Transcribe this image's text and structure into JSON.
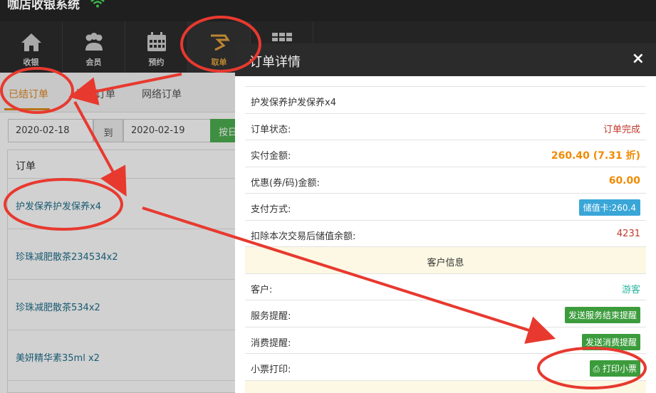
{
  "app": {
    "title": "咖店收银系统"
  },
  "nav": [
    {
      "label": "收银",
      "icon": "home-icon"
    },
    {
      "label": "会员",
      "icon": "users-icon"
    },
    {
      "label": "预约",
      "icon": "calendar-icon"
    },
    {
      "label": "取单",
      "icon": "takeout-icon"
    }
  ],
  "subtabs": [
    "已结订单",
    "挂起订单",
    "网络订单"
  ],
  "filter": {
    "start": "2020-02-18",
    "to": "到",
    "end": "2020-02-19",
    "query": "按日"
  },
  "orders": {
    "header": "订单",
    "rows": [
      "护发保养护发保养x4",
      "珍珠减肥散茶234534x2",
      "珍珠减肥散茶534x2",
      "美妍精华素35ml x2"
    ]
  },
  "modal": {
    "title": "订单详情",
    "close": "×",
    "product": "护发保养护发保养x4",
    "status_label": "订单状态:",
    "status_value": "订单完成",
    "paid_label": "实付金额:",
    "paid_value": "260.40 (7.31 折)",
    "discount_label": "优惠(券/码)金额:",
    "discount_value": "60.00",
    "method_label": "支付方式:",
    "method_value": "储值卡:260.4",
    "balance_label": "扣除本次交易后储值余额:",
    "balance_value": "4231",
    "customer_section": "客户信息",
    "customer_label": "客户:",
    "customer_value": "游客",
    "service_label": "服务提醒:",
    "service_btn": "发送服务结束提醒",
    "consume_label": "消费提醒:",
    "consume_btn": "发送消费提醒",
    "print_label": "小票打印:",
    "print_btn": "打印小票"
  },
  "colors": {
    "accent": "#e08a1e",
    "annotation": "#e8392f",
    "success": "#3c9c3c",
    "info": "#3aa6d8"
  }
}
